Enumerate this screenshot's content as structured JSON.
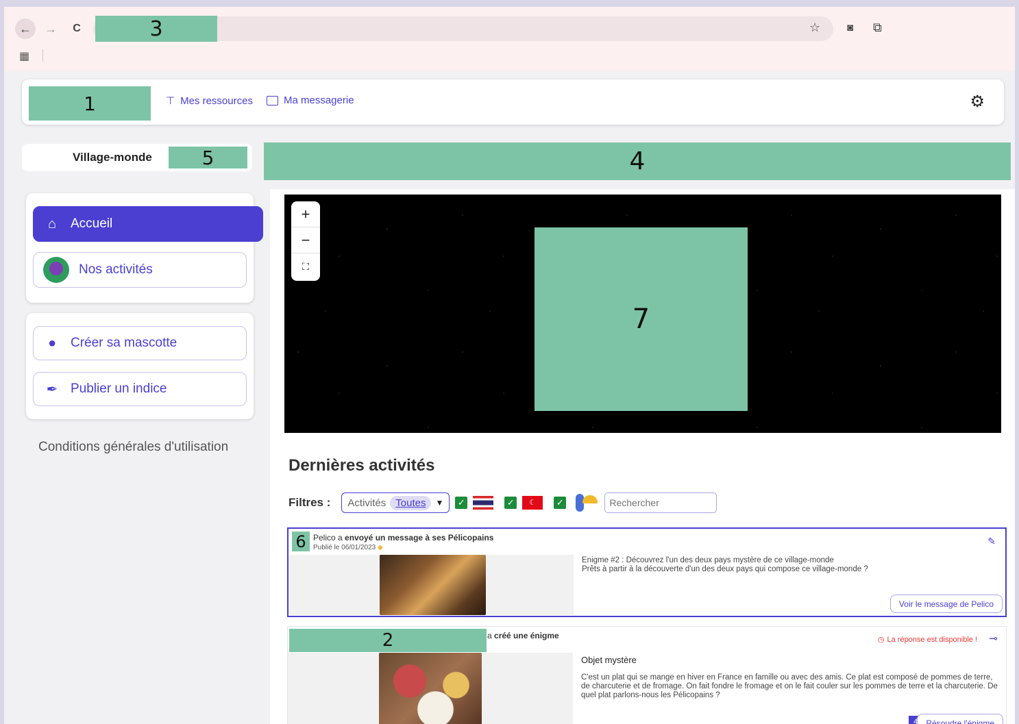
{
  "browser": {
    "back": "←",
    "forward": "→",
    "reload": "C",
    "address_label": "3"
  },
  "header": {
    "logo_label": "1",
    "links": [
      {
        "label": "Mes ressources",
        "icon": "pin-icon"
      },
      {
        "label": "Ma messagerie",
        "icon": "message-icon"
      }
    ],
    "settings_icon": "gear-icon"
  },
  "sidebar": {
    "village": "Village-monde",
    "village_placeholder": "5",
    "nav": [
      {
        "label": "Accueil",
        "icon": "home-icon",
        "active": true
      },
      {
        "label": "Nos activités",
        "icon": "mascot-avatar-icon",
        "active": false
      }
    ],
    "actions": [
      {
        "label": "Créer sa mascotte",
        "icon": "person-icon"
      },
      {
        "label": "Publier un indice",
        "icon": "feather-icon"
      }
    ],
    "cgu": "Conditions générales d'utilisation"
  },
  "banner_placeholder": "4",
  "map": {
    "zoom_in": "+",
    "zoom_out": "−",
    "fullscreen": "⛶",
    "globe_placeholder": "7"
  },
  "activities": {
    "title": "Dernières activités",
    "filters_label": "Filtres :",
    "select_label": "Activités",
    "select_value": "Toutes",
    "search_placeholder": "Rechercher",
    "colors": {
      "accent": "#4a3fd1",
      "check": "#1c8c3a",
      "danger": "#e53935"
    }
  },
  "posts": [
    {
      "author_placeholder": "6",
      "author": "Pelico a ",
      "action": "envoyé un message à ses Pélicopains",
      "date": "Publié le 06/01/2023",
      "line1": "Enigme #2 : Découvrez l'un des deux pays mystère de ce village-monde",
      "line2": "Prêts à partir à la découverte d'un des deux pays qui compose ce village-monde ?",
      "button": "Voir le message de Pelico",
      "pin_icon": "pin-icon"
    },
    {
      "author_placeholder": "2",
      "author": "a ",
      "action": "créé une énigme",
      "status": "La réponse est disponible !",
      "title": "Objet mystère",
      "body": "C'est un plat qui se mange en hiver en France en famille ou avec des amis. Ce plat est composé de pommes de terre, de charcuterie et de fromage. On fait fondre le fromage et on le fait couler sur les pommes de terre et la charcuterie. De quel plat parlons-nous les Pélicopains ?",
      "count": "4",
      "button": "Résoudre l'énigme"
    }
  ]
}
